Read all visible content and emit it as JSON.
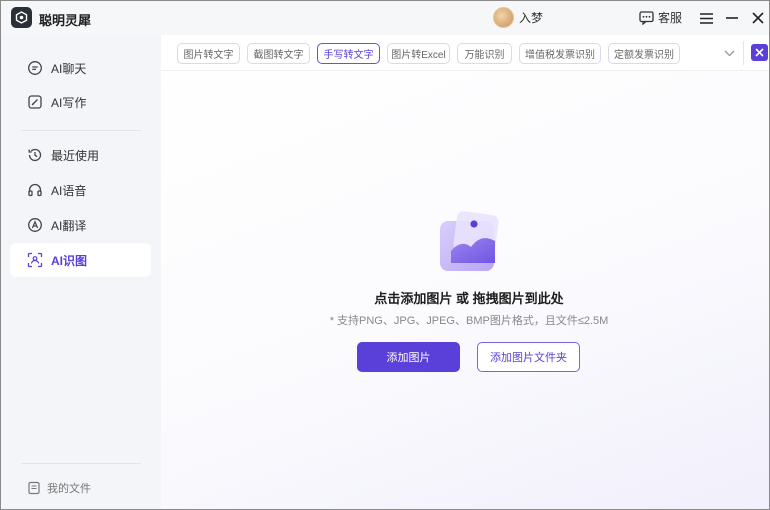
{
  "app": {
    "title": "聪明灵犀"
  },
  "user": {
    "name": "入梦"
  },
  "titlebar": {
    "service_label": "客服"
  },
  "sidebar": {
    "items": [
      {
        "label": "AI聊天",
        "icon": "chat-icon"
      },
      {
        "label": "AI写作",
        "icon": "write-icon"
      },
      {
        "label": "最近使用",
        "icon": "history-icon"
      },
      {
        "label": "AI语音",
        "icon": "headphones-icon"
      },
      {
        "label": "AI翻译",
        "icon": "translate-icon"
      },
      {
        "label": "AI识图",
        "icon": "scan-icon"
      }
    ],
    "active_index": 5,
    "footer_label": "我的文件"
  },
  "tabs": [
    {
      "label": "图片转文字"
    },
    {
      "label": "截图转文字"
    },
    {
      "label": "手写转文字"
    },
    {
      "label": "图片转Excel"
    },
    {
      "label": "万能识别"
    },
    {
      "label": "增值税发票识别"
    },
    {
      "label": "定额发票识别"
    }
  ],
  "active_tab": 2,
  "upload": {
    "title": "点击添加图片 或 拖拽图片到此处",
    "hint": "* 支持PNG、JPG、JPEG、BMP图片格式，且文件≤2.5M",
    "add_image_label": "添加图片",
    "add_folder_label": "添加图片文件夹"
  },
  "colors": {
    "accent": "#5b3fd9",
    "sidebar_bg": "#f4f5f8",
    "titlebar_bg": "#f6f7f9"
  }
}
